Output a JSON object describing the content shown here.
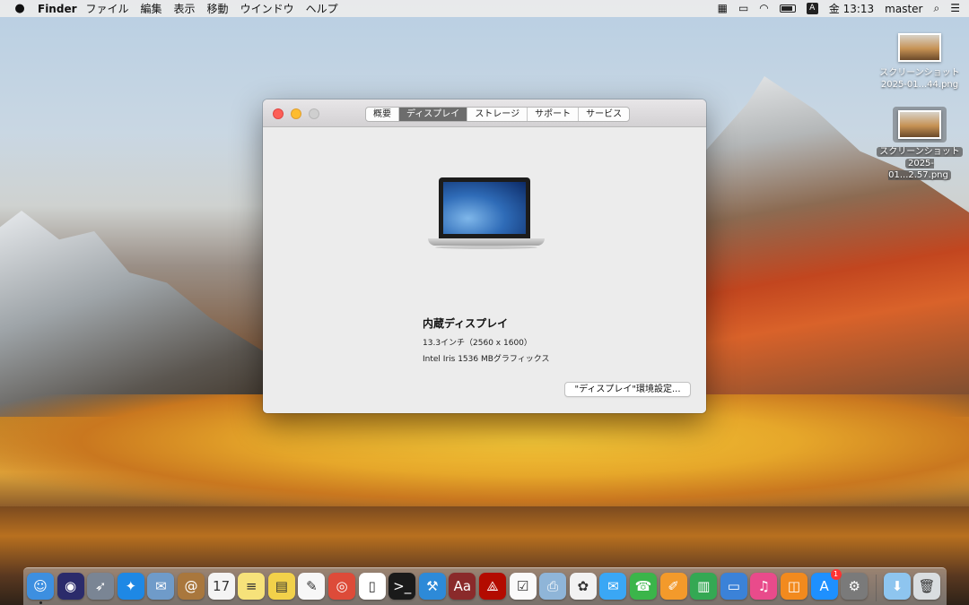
{
  "menubar": {
    "app_name": "Finder",
    "menus": [
      "ファイル",
      "編集",
      "表示",
      "移動",
      "ウインドウ",
      "ヘルプ"
    ],
    "input_source": "A",
    "clock": "金 13:13",
    "user": "master"
  },
  "desktop": {
    "files": [
      {
        "line1": "スクリーンショット",
        "line2": "2025-01...44.png"
      },
      {
        "line1": "スクリーンショット",
        "line2": "2025-01...2.57.png"
      }
    ]
  },
  "about_window": {
    "tabs": [
      "概要",
      "ディスプレイ",
      "ストレージ",
      "サポート",
      "サービス"
    ],
    "active_tab": "ディスプレイ",
    "display_name": "内蔵ディスプレイ",
    "display_size": "13.3インチ（2560 x 1600）",
    "graphics": "Intel Iris 1536 MBグラフィックス",
    "pref_button": "\"ディスプレイ\"環境設定..."
  },
  "dock": {
    "icons": [
      {
        "name": "finder-icon",
        "color": "#3d8fe0",
        "glyph": "☺"
      },
      {
        "name": "siri-icon",
        "color": "#2b2b6b",
        "glyph": "◉"
      },
      {
        "name": "launchpad-icon",
        "color": "#7a8594",
        "glyph": "➶"
      },
      {
        "name": "safari-icon",
        "color": "#1e88e5",
        "glyph": "✦"
      },
      {
        "name": "mail-icon",
        "color": "#6f9bc9",
        "glyph": "✉"
      },
      {
        "name": "contacts-icon",
        "color": "#a9773d",
        "glyph": "@"
      },
      {
        "name": "calendar-icon",
        "color": "#f4f4f4",
        "glyph": "17"
      },
      {
        "name": "notes-icon",
        "color": "#f6e27a",
        "glyph": "≡"
      },
      {
        "name": "stickies-icon",
        "color": "#f2d14a",
        "glyph": "▤"
      },
      {
        "name": "textedit-icon",
        "color": "#f7f7f7",
        "glyph": "✎"
      },
      {
        "name": "chrome-icon",
        "color": "#dd4b39",
        "glyph": "◎"
      },
      {
        "name": "document-icon",
        "color": "#ffffff",
        "glyph": "▯"
      },
      {
        "name": "terminal-icon",
        "color": "#1a1a1a",
        "glyph": ">_"
      },
      {
        "name": "xcode-icon",
        "color": "#2d8ad8",
        "glyph": "⚒"
      },
      {
        "name": "dictionary-icon",
        "color": "#8a2a2a",
        "glyph": "Aa"
      },
      {
        "name": "acrobat-icon",
        "color": "#b30b00",
        "glyph": "⟁"
      },
      {
        "name": "reminders-icon",
        "color": "#fafafa",
        "glyph": "☑"
      },
      {
        "name": "preview-icon",
        "color": "#8fb5d8",
        "glyph": "⎙"
      },
      {
        "name": "photos-icon",
        "color": "#f2f2f2",
        "glyph": "✿"
      },
      {
        "name": "messages-icon",
        "color": "#3aa7f5",
        "glyph": "✉"
      },
      {
        "name": "facetime-icon",
        "color": "#3bb54a",
        "glyph": "☎"
      },
      {
        "name": "pages-icon",
        "color": "#f39a2b",
        "glyph": "✐"
      },
      {
        "name": "numbers-icon",
        "color": "#34a853",
        "glyph": "▥"
      },
      {
        "name": "keynote-icon",
        "color": "#3b82d8",
        "glyph": "▭"
      },
      {
        "name": "itunes-icon",
        "color": "#e94b8b",
        "glyph": "♫"
      },
      {
        "name": "ibooks-icon",
        "color": "#f28a1e",
        "glyph": "◫"
      },
      {
        "name": "app-store-icon",
        "color": "#1e90ff",
        "glyph": "A",
        "badge": "1"
      },
      {
        "name": "system-preferences-icon",
        "color": "#7a7a7a",
        "glyph": "⚙"
      }
    ],
    "trailing": [
      {
        "name": "downloads-folder-icon",
        "color": "#8ec5ef",
        "glyph": "⬇"
      },
      {
        "name": "trash-icon",
        "color": "#d9dde0",
        "glyph": "🗑"
      }
    ]
  }
}
